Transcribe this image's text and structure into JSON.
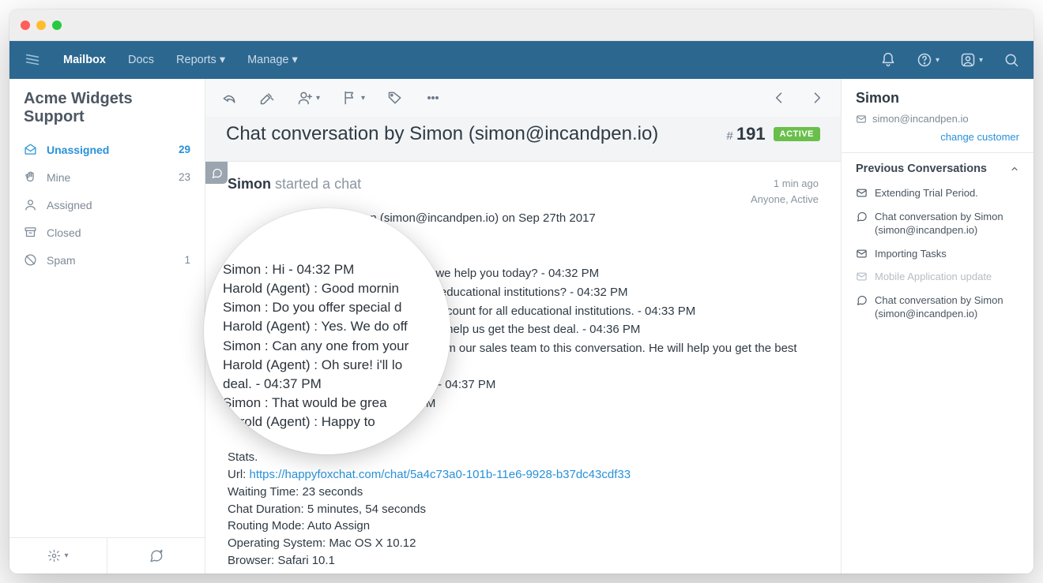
{
  "nav": {
    "mailbox": "Mailbox",
    "docs": "Docs",
    "reports": "Reports",
    "manage": "Manage"
  },
  "sidebar": {
    "title": "Acme Widgets Support",
    "items": [
      {
        "label": "Unassigned",
        "count": "29"
      },
      {
        "label": "Mine",
        "count": "23"
      },
      {
        "label": "Assigned",
        "count": ""
      },
      {
        "label": "Closed",
        "count": ""
      },
      {
        "label": "Spam",
        "count": "1"
      }
    ]
  },
  "conversation": {
    "title": "Chat conversation by Simon (simon@incandpen.io)",
    "id_prefix": "#",
    "id_number": "191",
    "active_badge": "ACTIVE",
    "author": "Simon",
    "action": "started a chat",
    "time_ago": "1 min ago",
    "status_line": "Anyone, Active",
    "prefix_visible": "on (simon@incandpen.io) on Sep 27th 2017",
    "transcript": [
      "w can we help you today? - 04:32 PM",
      "nts to educational institutions? - 04:32 PM",
      "0% discount for all educational institutions. - 04:33 PM",
      "s team help us get the best deal. - 04:36 PM",
      "John from our sales team to this conversation. He will help you get the best",
      "nks a lot - 04:37 PM",
      "- 04:38 PM"
    ],
    "stats": {
      "hdr": "Stats.",
      "url_label": "Url: ",
      "url": "https://happyfoxchat.com/chat/5a4c73a0-101b-11e6-9928-b37dc43cdf33",
      "waiting": "Waiting Time: 23 seconds",
      "duration": "Chat Duration: 5 minutes, 54 seconds",
      "routing": "Routing Mode: Auto Assign",
      "os": "Operating System: Mac OS X 10.12",
      "browser": "Browser: Safari 10.1"
    }
  },
  "magnifier": [
    "Simon : Hi - 04:32 PM",
    "Harold (Agent) : Good mornin",
    "Simon : Do you offer special d",
    "Harold (Agent) : Yes. We do off",
    "Simon : Can any one from your",
    "Harold (Agent) : Oh sure! i'll lo",
    "deal. - 04:37 PM",
    "Simon : That would be grea",
    "Harold (Agent) : Happy to"
  ],
  "customer": {
    "name": "Simon",
    "email": "simon@incandpen.io",
    "change": "change customer"
  },
  "previous": {
    "title": "Previous Conversations",
    "items": [
      {
        "type": "mail",
        "label": "Extending Trial Period."
      },
      {
        "type": "chat",
        "label": "Chat conversation by Simon (simon@incandpen.io)"
      },
      {
        "type": "mail",
        "label": "Importing Tasks"
      },
      {
        "type": "mail_dim",
        "label": "Mobile Application update"
      },
      {
        "type": "chat",
        "label": "Chat conversation by Simon (simon@incandpen.io)"
      }
    ]
  }
}
